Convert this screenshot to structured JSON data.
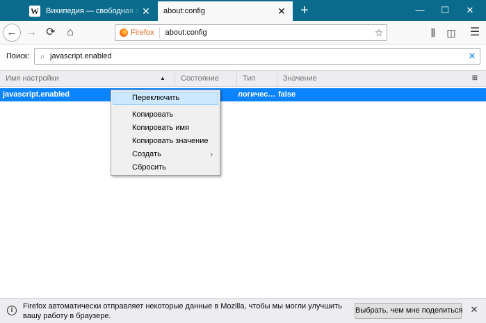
{
  "tabs": [
    {
      "favicon": "W",
      "title": "Википедия — свободная энц",
      "close": "✕"
    },
    {
      "title": "about:config",
      "close": "✕"
    }
  ],
  "new_tab": "+",
  "window_controls": {
    "minimize": "—",
    "maximize": "☐",
    "close": "✕"
  },
  "toolbar": {
    "identity_label": "Firefox",
    "url": "about:config",
    "icons": {
      "back": "←",
      "forward": "→",
      "reload": "⟳",
      "home": "⌂",
      "star": "☆",
      "library": "⫼",
      "sidebar": "◫",
      "menu": "☰"
    }
  },
  "search": {
    "label": "Поиск:",
    "value": "javascript.enabled",
    "icon": "⌕",
    "clear": "✕"
  },
  "table": {
    "columns": [
      "Имя настройки",
      "Состояние",
      "Тип",
      "Значение"
    ],
    "sort_arrow": "▲",
    "column_picker": "⊞",
    "rows": [
      {
        "name": "javascript.enabled",
        "type": "логичес…",
        "value": "false"
      }
    ]
  },
  "context_menu": {
    "items": [
      "Переключить",
      "Копировать",
      "Копировать имя",
      "Копировать значение",
      "Создать",
      "Сбросить"
    ],
    "submenu_arrow": "›"
  },
  "notification": {
    "icon": "i",
    "text": "Firefox автоматически отправляет некоторые данные в Mozilla, чтобы мы могли улучшить вашу работу в браузере.",
    "button": "Выбрать, чем мне поделиться",
    "close": "✕"
  },
  "colors": {
    "titlebar": "#0a6b8c",
    "selection": "#0a84ff",
    "menu_highlight": "#cce8ff"
  }
}
